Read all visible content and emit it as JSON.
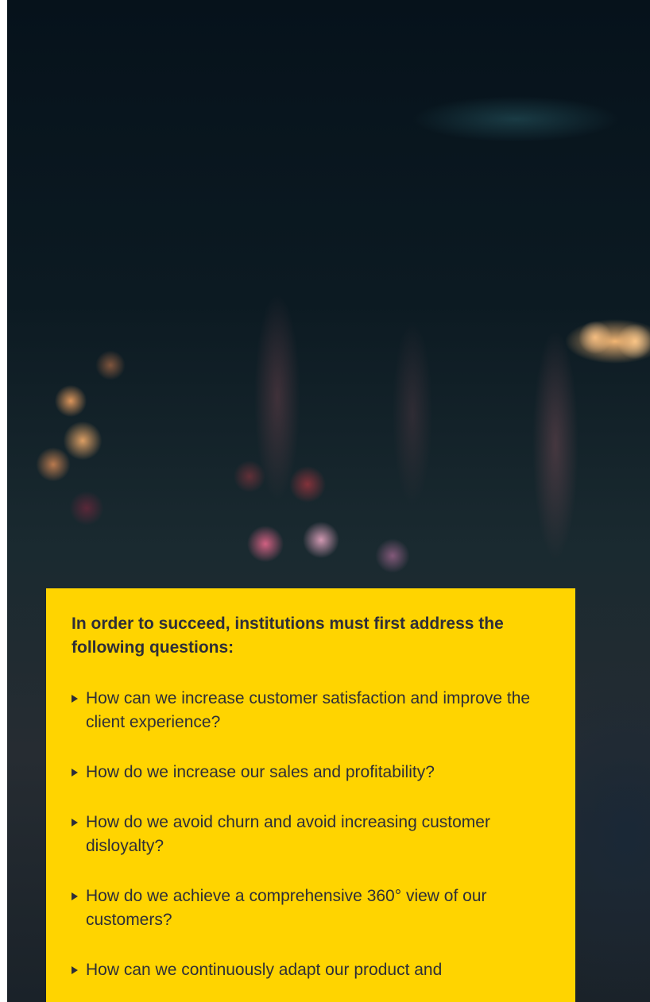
{
  "callout": {
    "heading": "In order to succeed, institutions must first address the following questions:",
    "questions": [
      "How can we increase customer satisfaction and improve the client experience?",
      "How do we increase our sales and profitability?",
      "How do we avoid churn and avoid increasing customer disloyalty?",
      "How do we achieve a comprehensive 360° view of our customers?",
      "How can we continuously adapt our product and"
    ]
  },
  "colors": {
    "callout_background": "#ffd400",
    "text": "#2e2e38"
  },
  "icons": {
    "bullet": "triangle-right-icon"
  }
}
